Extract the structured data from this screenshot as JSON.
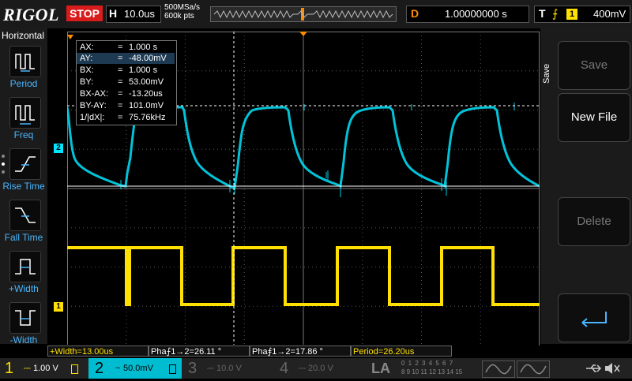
{
  "top": {
    "logo": "RIGOL",
    "run_state": "STOP",
    "h_label": "H",
    "timebase": "10.0us",
    "sample_rate": "500MSa/s",
    "memory_depth": "600k pts",
    "delay_label": "D",
    "delay_value": "1.00000000 s",
    "trigger_label": "T",
    "trigger_slope": "⨍",
    "trigger_source": "1",
    "trigger_level": "400mV"
  },
  "left_panel": {
    "title": "Horizontal",
    "items": [
      {
        "label": "Period"
      },
      {
        "label": "Freq"
      },
      {
        "label": "Rise Time"
      },
      {
        "label": "Fall Time"
      },
      {
        "label": "+Width"
      },
      {
        "label": "-Width"
      }
    ]
  },
  "cursor_table": [
    {
      "key": "AX:",
      "value": "1.000 s",
      "selected": false
    },
    {
      "key": "AY:",
      "value": "-48.00mV",
      "selected": true
    },
    {
      "key": "BX:",
      "value": "1.000 s",
      "selected": false
    },
    {
      "key": "BY:",
      "value": "53.00mV",
      "selected": false
    },
    {
      "key": "BX-AX:",
      "value": "-13.20us",
      "selected": false
    },
    {
      "key": "BY-AY:",
      "value": "101.0mV",
      "selected": false
    },
    {
      "key": "1/|dX|:",
      "value": "75.76kHz",
      "selected": false
    }
  ],
  "cursor_eq": "=",
  "right_panel": {
    "section_label": "Save",
    "buttons": [
      {
        "label": "Save",
        "enabled": false
      },
      {
        "label": "New File",
        "enabled": true
      },
      {
        "label": "Delete",
        "enabled": false
      },
      {
        "label": "",
        "icon": "enter-arrow-icon",
        "enabled": true
      }
    ]
  },
  "measurements": [
    {
      "text": "+Width=13.00us",
      "color": "#ffe000"
    },
    {
      "text": "Pha⨍1→2=26.11 °",
      "color": "#ffffff"
    },
    {
      "text": "Pha⨎1→2=17.86 °",
      "color": "#ffffff"
    },
    {
      "text": "Period=26.20us",
      "color": "#ffe000"
    }
  ],
  "channels": [
    {
      "num": "1",
      "coupling": "⎓",
      "scale": "1.00 V",
      "color": "#ffe000",
      "active": false
    },
    {
      "num": "2",
      "coupling": "~",
      "scale": "50.0mV",
      "color": "#00e5ff",
      "active": true
    },
    {
      "num": "3",
      "coupling": "⎓",
      "scale": "10.0 V",
      "color": "#666666",
      "active": false
    },
    {
      "num": "4",
      "coupling": "⎓",
      "scale": "20.0 V",
      "color": "#666666",
      "active": false
    }
  ],
  "la_label": "LA",
  "la_digits_row1": "0 1 2 3 4 5 6 7",
  "la_digits_row2": "8 9 10 11 12 13 14 15",
  "markers": {
    "ch1": "1",
    "ch2": "2",
    "trigger_right": "T"
  },
  "colors": {
    "ch1": "#ffe000",
    "ch2": "#00e5ff",
    "accent_blue": "#49b6ff",
    "stop_red": "#d81c1c",
    "marker_orange": "#ff8c00"
  }
}
